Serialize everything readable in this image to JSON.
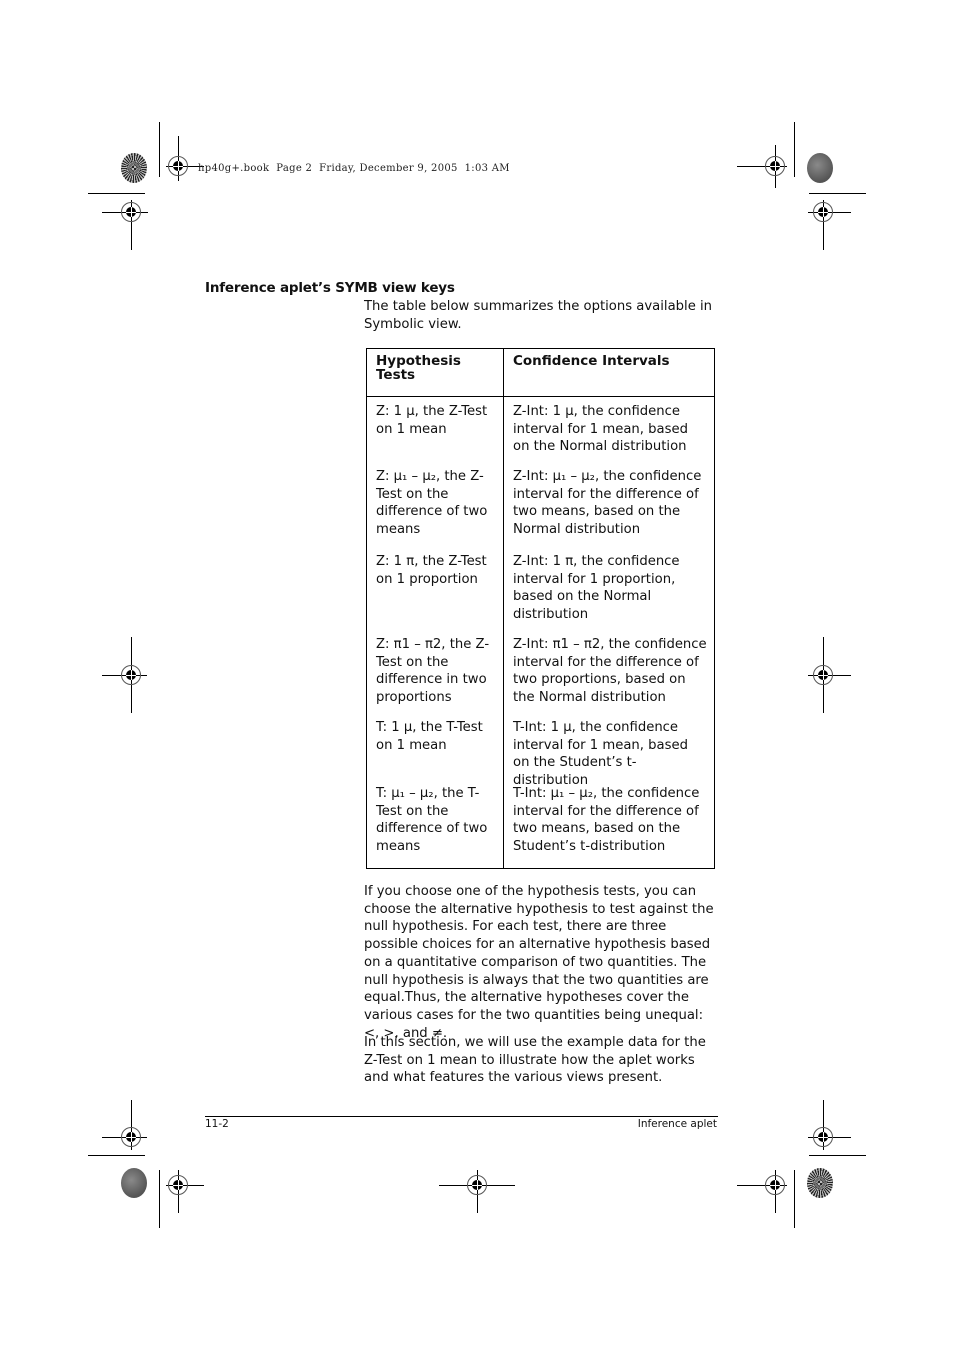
{
  "print_slug": "hp40g+.book  Page 2  Friday, December 9, 2005  1:03 AM",
  "section": {
    "heading": "Inference aplet’s SYMB view keys",
    "intro": "The table below summarizes the options available in Symbolic view."
  },
  "table": {
    "headers": [
      "Hypothesis Tests",
      "Confidence Intervals"
    ],
    "rows": [
      [
        "Z: 1 μ, the Z-Test on 1 mean",
        "Z-Int: 1 μ, the confidence interval for 1 mean, based on the Normal distribution"
      ],
      [
        "Z: μ₁ – μ₂, the Z-Test on the difference of two means",
        "Z-Int: μ₁ – μ₂, the confidence interval for the difference of two means, based on the Normal distribution"
      ],
      [
        "Z: 1 π, the Z-Test on 1 proportion",
        "Z-Int: 1 π, the confidence interval for 1 proportion, based on the Normal distribution"
      ],
      [
        "Z: π1 – π2, the Z-Test on the difference in two proportions",
        "Z-Int: π1 – π2, the confidence interval for the difference of two proportions, based on the Normal distribution"
      ],
      [
        "T: 1 μ, the T-Test on 1 mean",
        "T-Int: 1 μ, the confidence interval for 1 mean, based on the Student’s t-distribution"
      ],
      [
        "T: μ₁ – μ₂, the T-Test on the difference of two means",
        "T-Int: μ₁ – μ₂, the confidence interval for the difference of two means, based on the Student’s t-distribution"
      ]
    ]
  },
  "paragraphs": [
    "If you choose one of the hypothesis tests, you can choose the alternative hypothesis to test against the null hypothesis. For each test, there are three possible choices for an alternative hypothesis based on a quantitative comparison of two quantities. The null hypothesis is always that the two quantities are equal.Thus, the alternative hypotheses cover the various cases for the two quantities being unequal: <, >, and ≠.",
    "In this section, we will use the example data for the Z-Test on 1 mean to illustrate how the aplet works and what features the various views present."
  ],
  "footer": {
    "page_number": "11-2",
    "chapter": "Inference aplet"
  },
  "marks": {
    "registration_icon": "registration-crosshair",
    "color_bar_icon": "starburst-target"
  }
}
